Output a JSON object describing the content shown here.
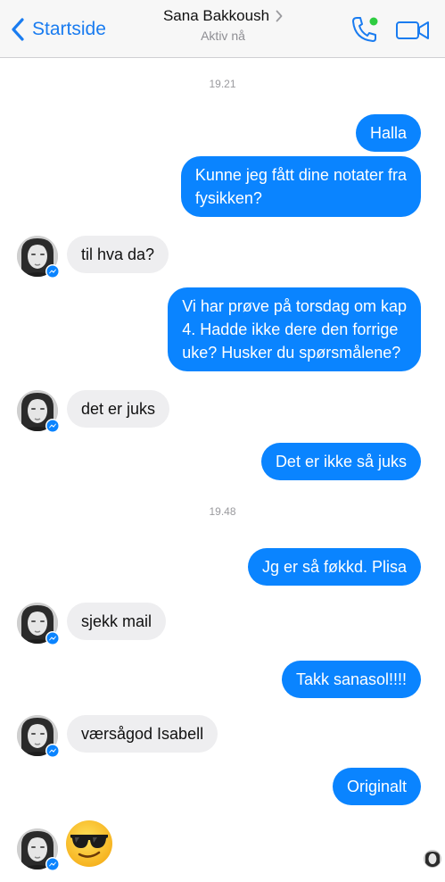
{
  "header": {
    "back_label": "Startside",
    "contact_name": "Sana Bakkoush",
    "status": "Aktiv nå",
    "accent_color": "#1a7cf0",
    "online_dot_color": "#2ecc40"
  },
  "icons": {
    "back": "chevron-left-icon",
    "contact_chevron": "chevron-right-icon",
    "call": "phone-icon",
    "video": "video-camera-icon",
    "messenger_badge": "messenger-badge-icon",
    "emoji": "sunglasses-emoji-icon"
  },
  "colors": {
    "outgoing_bubble": "#0a84ff",
    "incoming_bubble": "#eeeef0"
  },
  "thread": {
    "timestamp_1": "19.21",
    "timestamp_2": "19.48",
    "messages": [
      {
        "direction": "out",
        "text": "Halla"
      },
      {
        "direction": "out",
        "line1": "Kunne jeg fått dine notater fra",
        "line2": "fysikken?"
      },
      {
        "direction": "in",
        "text": "til hva da?"
      },
      {
        "direction": "out",
        "line1": "Vi har prøve på torsdag om kap",
        "line2": "4. Hadde ikke dere den forrige",
        "line3": "uke? Husker du spørsmålene?"
      },
      {
        "direction": "in",
        "text": "det er juks"
      },
      {
        "direction": "out",
        "text": "Det er ikke så juks"
      },
      {
        "direction": "out",
        "text": "Jg er så føkkd. Plisa"
      },
      {
        "direction": "in",
        "text": "sjekk mail"
      },
      {
        "direction": "out",
        "text": "Takk sanasol!!!!"
      },
      {
        "direction": "in",
        "text": "værsågod Isabell"
      },
      {
        "direction": "out",
        "text": "Originalt"
      },
      {
        "direction": "in",
        "emoji": "sunglasses-emoji-icon"
      }
    ]
  }
}
